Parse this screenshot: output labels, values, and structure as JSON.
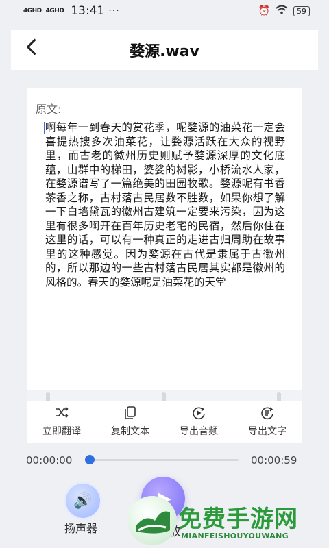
{
  "status": {
    "signal1": "4GHD",
    "signal2": "4GHD",
    "time": "13:41",
    "dots": "···",
    "battery": "59"
  },
  "header": {
    "title": "婺源.wav"
  },
  "content": {
    "label": "原文:",
    "text": "啊每年一到春天的赏花季，呢婺源的油菜花一定会喜提热搜多次油菜花，让婺源活跃在大众的视野里，而古老的徽州历史则赋予婺源深厚的文化底蕴，山群中的梯田，婆娑的树影，小桥流水人家，在婺源谱写了一篇绝美的田园牧歌。婺源呢有书香茶香之称，古村落古民居数不胜数，如果你想了解一下白墙黛瓦的徽州古建筑一定要来污染，因为这里有很多啊开在百年历史老宅的民宿，然后你住在这里的话，可以有一种真正的走进古归周助在故事里的这种感觉。因为婺源在古代是隶属于古徽州的，所以那边的一些古村落古民居其实都是徽州的风格的。春天的婺源呢是油菜花的天堂"
  },
  "toolbar": {
    "items": [
      {
        "label": "立即翻译",
        "icon": "shuffle-icon"
      },
      {
        "label": "复制文本",
        "icon": "copy-icon"
      },
      {
        "label": "导出音频",
        "icon": "export-audio-icon"
      },
      {
        "label": "导出文字",
        "icon": "export-text-icon"
      }
    ]
  },
  "player": {
    "current_time": "00:00:00",
    "total_time": "00:00:59",
    "progress": 0,
    "speaker_label": "扬声器",
    "play_label": "播放"
  },
  "watermark": {
    "title": "免费手游网",
    "subtitle": "MIANFEISHOUYOUWANG"
  },
  "colors": {
    "accent": "#2f6fe0",
    "play_button": "#7a6cf5",
    "watermark": "#2a9a3a"
  }
}
